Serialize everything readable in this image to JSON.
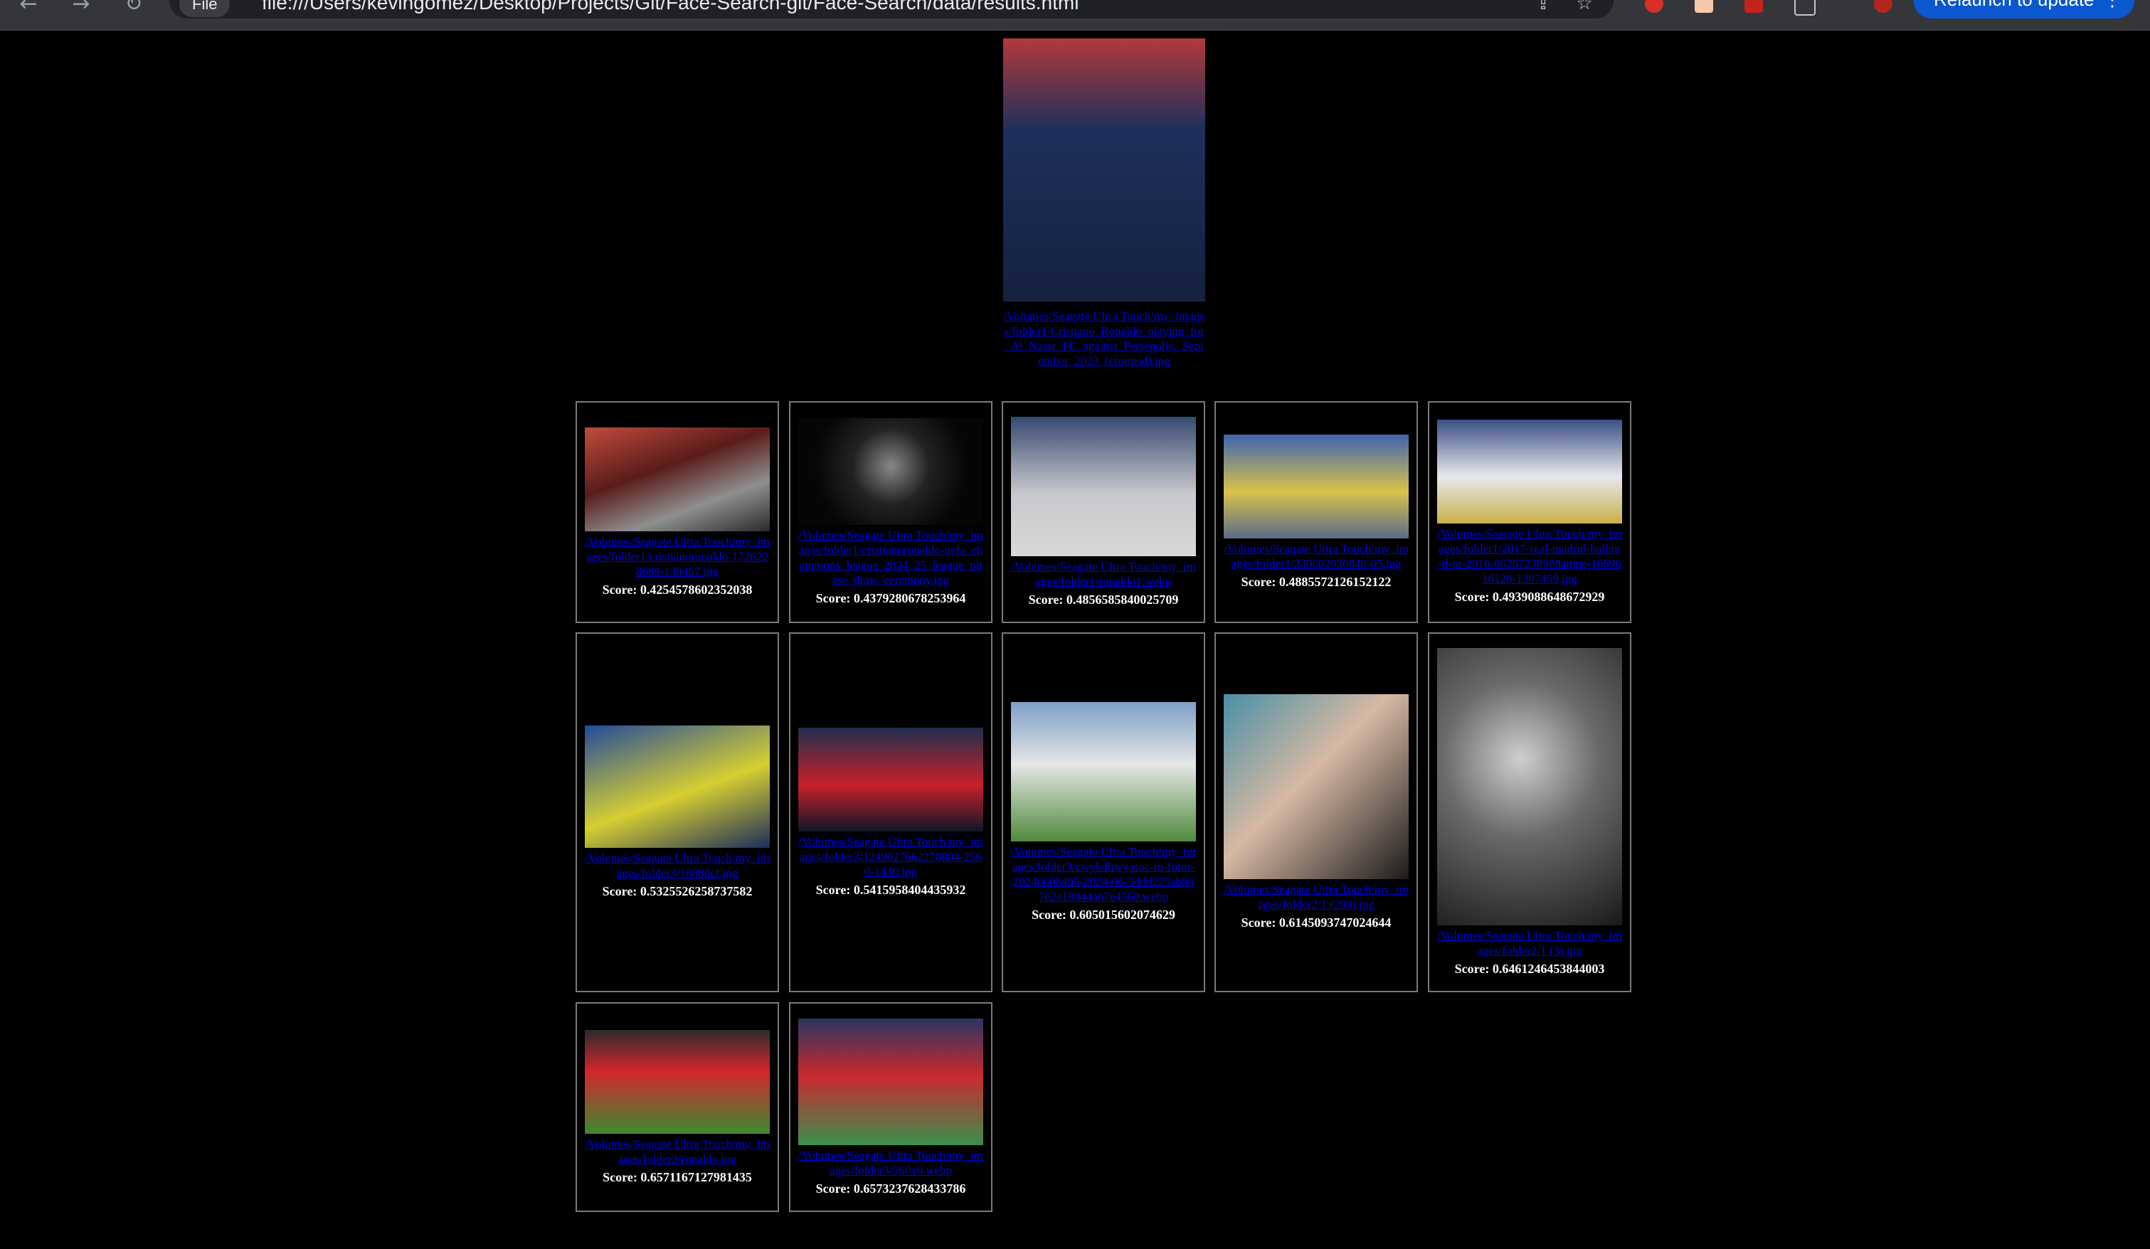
{
  "browser": {
    "site_info": "File",
    "url": "file:///Users/kevingomez/Desktop/Projects/Git/Face-Search-git/Face-Search/data/results.html",
    "relaunch_label": "Relaunch to update",
    "back_icon": "←",
    "forward_icon": "→",
    "reload_icon": "↻",
    "share_icon": "⇪",
    "star_icon": "☆",
    "menu_icon": "⋮"
  },
  "query": {
    "path": "/Volumes/Seagate Ultra Touch/my_images/folder1/Cristiano_Ronaldo_playing_for_Al_Nassr_FC_against_Persepolis,_September_2023_(cropped).jpg"
  },
  "results": [
    {
      "path": "/Volumes/Seagate Ultra Touch/my_images/folder1/cristianoronaldo-1726228689-139467.jpg",
      "score": "Score: 0.4254578602352038"
    },
    {
      "path": "/Volumes/Seagate Ultra Touch/my_images/folder1/cristianoronaldo-uefa_champions_league_2024_25_league_phase_draw_ceremony.jpg",
      "score": "Score: 0.4379280678253964"
    },
    {
      "path": "/Volumes/Seagate Ultra Touch/my_images/folder1/ronaldo1.webp",
      "score": "Score: 0.4856585840025709"
    },
    {
      "path": "/Volumes/Seagate Ultra Touch/my_images/folder1/230602030840-05.jpg",
      "score": "Score: 0.4885572126152122"
    },
    {
      "path": "/Volumes/Seagate Ultra Touch/my_images/folder1/2017-real-madrid-ballon-d-or-2016-00267238908ampe-1669616128-1307459.jpg",
      "score": "Score: 0.4939088648672929"
    },
    {
      "path": "/Volumes/Seagate Ultra Touch/my_images/folder3/1688dcf.jpg",
      "score": "Score: 0.5325526258737582"
    },
    {
      "path": "/Volumes/Seagate Ultra Touch/my_images/folder3/1249027662278804-2560-1440.jpg",
      "score": "Score: 0.5415958404435932"
    },
    {
      "path": "/Volumes/Seagate Ultra Touch/my_images/folder3/cwykdhwyasoc-m-fotor-20240608495-2024-06-5ddd225ab96762e18844a67e4560.webp",
      "score": "Score: 0.605015602074629"
    },
    {
      "path": "/Volumes/Seagate Ultra Touch/my_images/folder2/1 (298).jpg",
      "score": "Score: 0.6145093747024644"
    },
    {
      "path": "/Volumes/Seagate Ultra Touch/my_images/folder2/1 (3).jpg",
      "score": "Score: 0.6461246453844003"
    },
    {
      "path": "/Volumes/Seagate Ultra Touch/my_images/folder3/ronaldo.jpg",
      "score": "Score: 0.6571167127981435"
    },
    {
      "path": "/Volumes/Seagate Ultra Touch/my_images/folder3/960x0.webp",
      "score": "Score: 0.6573237628433786"
    }
  ]
}
